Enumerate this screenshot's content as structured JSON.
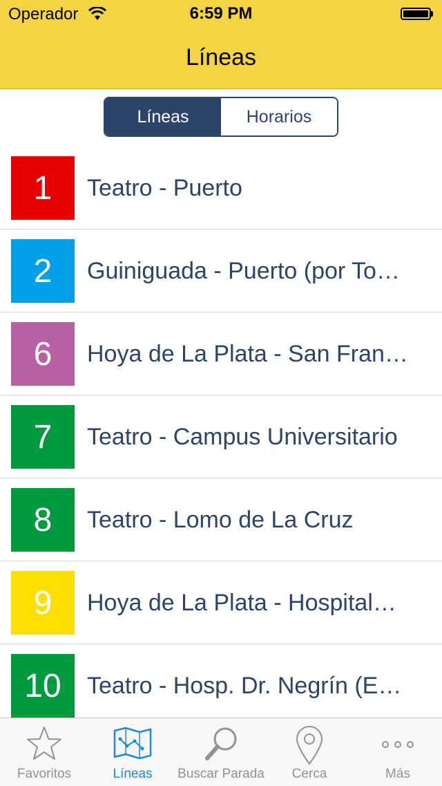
{
  "status": {
    "carrier": "Operador",
    "time": "6:59 PM"
  },
  "nav": {
    "title": "Líneas"
  },
  "segments": [
    {
      "label": "Líneas",
      "selected": true
    },
    {
      "label": "Horarios",
      "selected": false
    }
  ],
  "lines": [
    {
      "number": "1",
      "name": "Teatro - Puerto",
      "color": "#e60000"
    },
    {
      "number": "2",
      "name": "Guiniguada - Puerto (por To…",
      "color": "#00a0e9"
    },
    {
      "number": "6",
      "name": "Hoya de La Plata - San Fran…",
      "color": "#b760a6"
    },
    {
      "number": "7",
      "name": "Teatro - Campus Universitario",
      "color": "#009a3e"
    },
    {
      "number": "8",
      "name": "Teatro - Lomo de La Cruz",
      "color": "#009a3e"
    },
    {
      "number": "9",
      "name": "Hoya de La Plata - Hospital…",
      "color": "#ffdf00"
    },
    {
      "number": "10",
      "name": "Teatro - Hosp. Dr. Negrín (E…",
      "color": "#009a3e"
    }
  ],
  "tabs": [
    {
      "label": "Favoritos",
      "icon": "star-icon",
      "active": false
    },
    {
      "label": "Líneas",
      "icon": "map-icon",
      "active": true
    },
    {
      "label": "Buscar Parada",
      "icon": "search-icon",
      "active": false
    },
    {
      "label": "Cerca",
      "icon": "location-pin-icon",
      "active": false
    },
    {
      "label": "Más",
      "icon": "more-icon",
      "active": false
    }
  ],
  "colors": {
    "bar": "#f4d442",
    "accent": "#2c4469",
    "tab_active": "#1a8ae0",
    "tab_inactive": "#929292"
  }
}
